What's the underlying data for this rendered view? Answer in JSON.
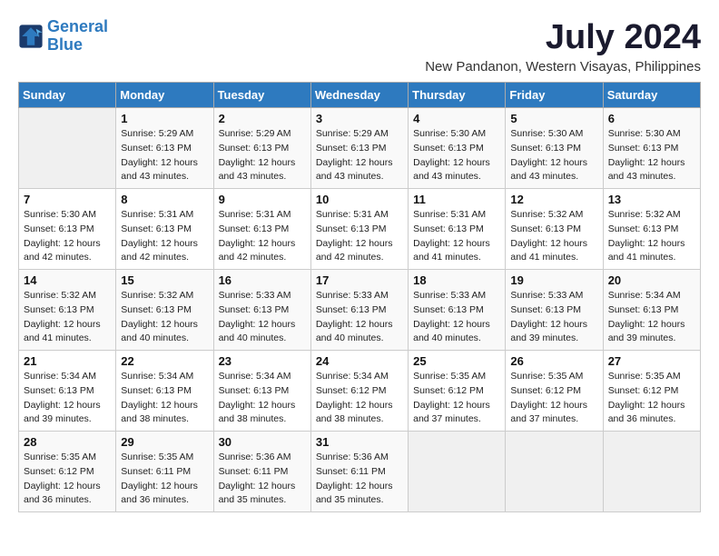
{
  "logo": {
    "line1": "General",
    "line2": "Blue"
  },
  "title": "July 2024",
  "location": "New Pandanon, Western Visayas, Philippines",
  "days_of_week": [
    "Sunday",
    "Monday",
    "Tuesday",
    "Wednesday",
    "Thursday",
    "Friday",
    "Saturday"
  ],
  "weeks": [
    [
      {
        "day": "",
        "sunrise": "",
        "sunset": "",
        "daylight": ""
      },
      {
        "day": "1",
        "sunrise": "Sunrise: 5:29 AM",
        "sunset": "Sunset: 6:13 PM",
        "daylight": "Daylight: 12 hours and 43 minutes."
      },
      {
        "day": "2",
        "sunrise": "Sunrise: 5:29 AM",
        "sunset": "Sunset: 6:13 PM",
        "daylight": "Daylight: 12 hours and 43 minutes."
      },
      {
        "day": "3",
        "sunrise": "Sunrise: 5:29 AM",
        "sunset": "Sunset: 6:13 PM",
        "daylight": "Daylight: 12 hours and 43 minutes."
      },
      {
        "day": "4",
        "sunrise": "Sunrise: 5:30 AM",
        "sunset": "Sunset: 6:13 PM",
        "daylight": "Daylight: 12 hours and 43 minutes."
      },
      {
        "day": "5",
        "sunrise": "Sunrise: 5:30 AM",
        "sunset": "Sunset: 6:13 PM",
        "daylight": "Daylight: 12 hours and 43 minutes."
      },
      {
        "day": "6",
        "sunrise": "Sunrise: 5:30 AM",
        "sunset": "Sunset: 6:13 PM",
        "daylight": "Daylight: 12 hours and 43 minutes."
      }
    ],
    [
      {
        "day": "7",
        "sunrise": "Sunrise: 5:30 AM",
        "sunset": "Sunset: 6:13 PM",
        "daylight": "Daylight: 12 hours and 42 minutes."
      },
      {
        "day": "8",
        "sunrise": "Sunrise: 5:31 AM",
        "sunset": "Sunset: 6:13 PM",
        "daylight": "Daylight: 12 hours and 42 minutes."
      },
      {
        "day": "9",
        "sunrise": "Sunrise: 5:31 AM",
        "sunset": "Sunset: 6:13 PM",
        "daylight": "Daylight: 12 hours and 42 minutes."
      },
      {
        "day": "10",
        "sunrise": "Sunrise: 5:31 AM",
        "sunset": "Sunset: 6:13 PM",
        "daylight": "Daylight: 12 hours and 42 minutes."
      },
      {
        "day": "11",
        "sunrise": "Sunrise: 5:31 AM",
        "sunset": "Sunset: 6:13 PM",
        "daylight": "Daylight: 12 hours and 41 minutes."
      },
      {
        "day": "12",
        "sunrise": "Sunrise: 5:32 AM",
        "sunset": "Sunset: 6:13 PM",
        "daylight": "Daylight: 12 hours and 41 minutes."
      },
      {
        "day": "13",
        "sunrise": "Sunrise: 5:32 AM",
        "sunset": "Sunset: 6:13 PM",
        "daylight": "Daylight: 12 hours and 41 minutes."
      }
    ],
    [
      {
        "day": "14",
        "sunrise": "Sunrise: 5:32 AM",
        "sunset": "Sunset: 6:13 PM",
        "daylight": "Daylight: 12 hours and 41 minutes."
      },
      {
        "day": "15",
        "sunrise": "Sunrise: 5:32 AM",
        "sunset": "Sunset: 6:13 PM",
        "daylight": "Daylight: 12 hours and 40 minutes."
      },
      {
        "day": "16",
        "sunrise": "Sunrise: 5:33 AM",
        "sunset": "Sunset: 6:13 PM",
        "daylight": "Daylight: 12 hours and 40 minutes."
      },
      {
        "day": "17",
        "sunrise": "Sunrise: 5:33 AM",
        "sunset": "Sunset: 6:13 PM",
        "daylight": "Daylight: 12 hours and 40 minutes."
      },
      {
        "day": "18",
        "sunrise": "Sunrise: 5:33 AM",
        "sunset": "Sunset: 6:13 PM",
        "daylight": "Daylight: 12 hours and 40 minutes."
      },
      {
        "day": "19",
        "sunrise": "Sunrise: 5:33 AM",
        "sunset": "Sunset: 6:13 PM",
        "daylight": "Daylight: 12 hours and 39 minutes."
      },
      {
        "day": "20",
        "sunrise": "Sunrise: 5:34 AM",
        "sunset": "Sunset: 6:13 PM",
        "daylight": "Daylight: 12 hours and 39 minutes."
      }
    ],
    [
      {
        "day": "21",
        "sunrise": "Sunrise: 5:34 AM",
        "sunset": "Sunset: 6:13 PM",
        "daylight": "Daylight: 12 hours and 39 minutes."
      },
      {
        "day": "22",
        "sunrise": "Sunrise: 5:34 AM",
        "sunset": "Sunset: 6:13 PM",
        "daylight": "Daylight: 12 hours and 38 minutes."
      },
      {
        "day": "23",
        "sunrise": "Sunrise: 5:34 AM",
        "sunset": "Sunset: 6:13 PM",
        "daylight": "Daylight: 12 hours and 38 minutes."
      },
      {
        "day": "24",
        "sunrise": "Sunrise: 5:34 AM",
        "sunset": "Sunset: 6:12 PM",
        "daylight": "Daylight: 12 hours and 38 minutes."
      },
      {
        "day": "25",
        "sunrise": "Sunrise: 5:35 AM",
        "sunset": "Sunset: 6:12 PM",
        "daylight": "Daylight: 12 hours and 37 minutes."
      },
      {
        "day": "26",
        "sunrise": "Sunrise: 5:35 AM",
        "sunset": "Sunset: 6:12 PM",
        "daylight": "Daylight: 12 hours and 37 minutes."
      },
      {
        "day": "27",
        "sunrise": "Sunrise: 5:35 AM",
        "sunset": "Sunset: 6:12 PM",
        "daylight": "Daylight: 12 hours and 36 minutes."
      }
    ],
    [
      {
        "day": "28",
        "sunrise": "Sunrise: 5:35 AM",
        "sunset": "Sunset: 6:12 PM",
        "daylight": "Daylight: 12 hours and 36 minutes."
      },
      {
        "day": "29",
        "sunrise": "Sunrise: 5:35 AM",
        "sunset": "Sunset: 6:11 PM",
        "daylight": "Daylight: 12 hours and 36 minutes."
      },
      {
        "day": "30",
        "sunrise": "Sunrise: 5:36 AM",
        "sunset": "Sunset: 6:11 PM",
        "daylight": "Daylight: 12 hours and 35 minutes."
      },
      {
        "day": "31",
        "sunrise": "Sunrise: 5:36 AM",
        "sunset": "Sunset: 6:11 PM",
        "daylight": "Daylight: 12 hours and 35 minutes."
      },
      {
        "day": "",
        "sunrise": "",
        "sunset": "",
        "daylight": ""
      },
      {
        "day": "",
        "sunrise": "",
        "sunset": "",
        "daylight": ""
      },
      {
        "day": "",
        "sunrise": "",
        "sunset": "",
        "daylight": ""
      }
    ]
  ]
}
